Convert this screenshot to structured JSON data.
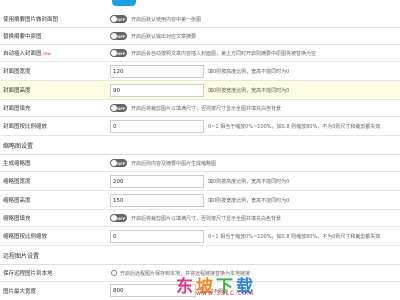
{
  "rows": {
    "use_cover_as_thumb": {
      "label": "使用摘要图片做封面图",
      "toggle": "OFF",
      "hint": "开启后默认使用内容中第一张图"
    },
    "replace_summary_images": {
      "label": "替换摘要中原图",
      "toggle": "OFF",
      "hint": "开启后默认输出对应文章摘要"
    },
    "auto_insert_cover": {
      "label": "自动插入封面图",
      "badge": "new",
      "toggle": "OFF",
      "hint": "开启后会自动按照文章内容插入封面图，第上方同时开启则摘要中原图将被替换为空"
    },
    "cover_width": {
      "label": "封面图宽度",
      "value": "120",
      "hint": "填0则按高度比例，宽高不能同时为0"
    },
    "cover_height": {
      "label": "封面图高度",
      "value": "90",
      "hint": "填0则按宽度比例，宽高不能同时为0"
    },
    "cover_fill": {
      "label": "封面图填充",
      "toggle": "OFF",
      "hint": "开启后将裁剪图片以填满尺寸，否则按尺寸显示全图并填充白色背景"
    },
    "cover_scale": {
      "label": "封面图按比例缩放",
      "value": "0",
      "hint": "0~1 相当于缩放0%~100%，如0.8 则缩放80%，不为0则尺寸和裁剪都失效"
    }
  },
  "sections": {
    "thumb_settings": "缩略图设置",
    "image_settings": "远程图片设置"
  },
  "thumb_rows": {
    "generate_thumb": {
      "label": "生成缩略图",
      "toggle": "OFF",
      "hint": "开启后则内容及摘要中图片生成缩略图"
    },
    "thumb_width": {
      "label": "缩略图宽度",
      "value": "200",
      "hint": "填0则按高度比例，宽高不能同时为0"
    },
    "thumb_height": {
      "label": "缩略图高度",
      "value": "150",
      "hint": "填0则按宽度比例，宽高不能同时为0"
    },
    "thumb_fill": {
      "label": "缩略图填充",
      "toggle": "OFF",
      "hint": "开启后将裁剪图片以填满尺寸，否则按尺寸显示全图并填充白色背景"
    },
    "thumb_scale": {
      "label": "缩略图按比例缩放",
      "value": "0",
      "hint": "0~1 相当于缩放0%~100%，如0.8 则缩放80%，不为0则尺寸和裁剪都失效"
    }
  },
  "image_rows": {
    "save_remote": {
      "label": "保存远程图片到本地",
      "hint": "开启后远程图片保存到本地，并将远程链接替换为本地链接"
    },
    "max_width": {
      "label": "图片最大宽度",
      "value": "800",
      "hint": "填0则不限制"
    }
  },
  "watermark": {
    "text": [
      "东",
      "坡",
      "下",
      "载"
    ],
    "url": "www.33LC.com"
  },
  "colors": {
    "toggle_off": "#666666",
    "highlight": "#fdfbe2",
    "accent": "#1e9fff"
  }
}
